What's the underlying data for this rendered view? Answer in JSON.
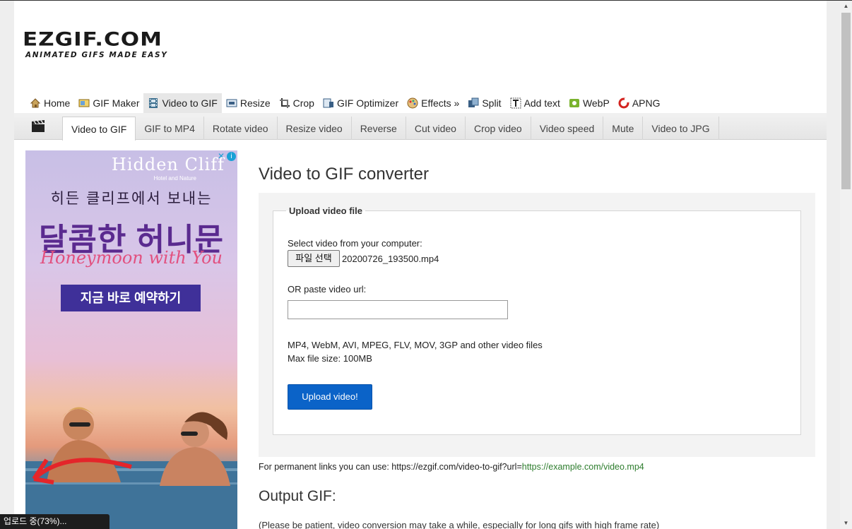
{
  "logo": {
    "main": "EZGIF.COM",
    "tagline": "ANIMATED GIFS MADE EASY"
  },
  "main_nav": [
    {
      "label": "Home",
      "icon": "home-icon"
    },
    {
      "label": "GIF Maker",
      "icon": "gif-maker-icon"
    },
    {
      "label": "Video to GIF",
      "icon": "film-icon",
      "active": true
    },
    {
      "label": "Resize",
      "icon": "resize-icon"
    },
    {
      "label": "Crop",
      "icon": "crop-icon"
    },
    {
      "label": "GIF Optimizer",
      "icon": "optimizer-icon"
    },
    {
      "label": "Effects »",
      "icon": "effects-icon"
    },
    {
      "label": "Split",
      "icon": "split-icon"
    },
    {
      "label": "Add text",
      "icon": "add-text-icon"
    },
    {
      "label": "WebP",
      "icon": "webp-icon"
    },
    {
      "label": "APNG",
      "icon": "apng-icon"
    }
  ],
  "sub_nav": [
    {
      "label": "Video to GIF",
      "active": true
    },
    {
      "label": "GIF to MP4"
    },
    {
      "label": "Rotate video"
    },
    {
      "label": "Resize video"
    },
    {
      "label": "Reverse"
    },
    {
      "label": "Cut video"
    },
    {
      "label": "Crop video"
    },
    {
      "label": "Video speed"
    },
    {
      "label": "Mute"
    },
    {
      "label": "Video to JPG"
    }
  ],
  "ad": {
    "brand": "Hidden Cliff",
    "brand_sub": "Hotel and Nature",
    "line1": "히든 클리프에서 보내는",
    "line2": "달콤한 허니문",
    "line3": "Honeymoon with You",
    "cta": "지금 바로 예약하기"
  },
  "page": {
    "title": "Video to GIF converter",
    "upload": {
      "legend": "Upload video file",
      "select_label": "Select video from your computer:",
      "file_button": "파일 선택",
      "file_name": "20200726_193500.mp4",
      "url_label": "OR paste video url:",
      "url_value": "",
      "formats": "MP4, WebM, AVI, MPEG, FLV, MOV, 3GP and other video files",
      "max_size": "Max file size: 100MB",
      "upload_button": "Upload video!"
    },
    "permlink_prefix": "For permanent links you can use: https://ezgif.com/video-to-gif?url=",
    "permlink_example": "https://example.com/video.mp4",
    "output_title": "Output GIF:",
    "patience": "(Please be patient, video conversion may take a while, especially for long gifs with high frame rate)"
  },
  "status_bar": "업로드 중(73%)..."
}
